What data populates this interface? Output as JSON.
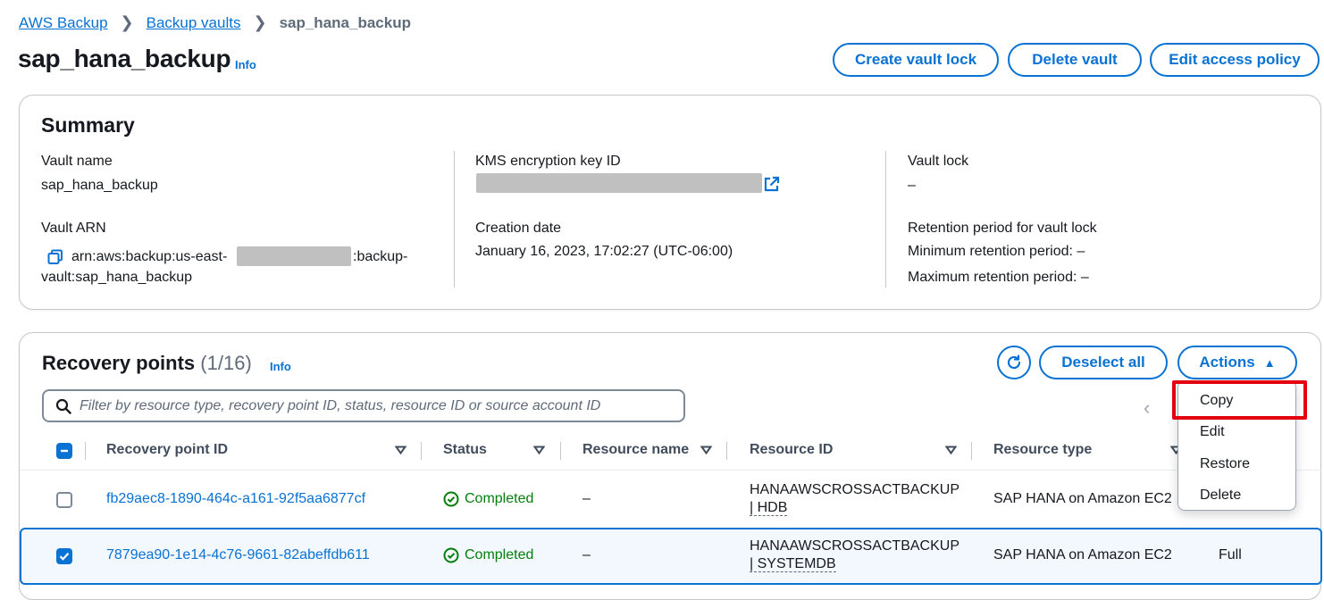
{
  "breadcrumb": {
    "items": [
      "AWS Backup",
      "Backup vaults"
    ],
    "current": "sap_hana_backup"
  },
  "page": {
    "title": "sap_hana_backup",
    "info": "Info"
  },
  "header_actions": {
    "create_vault_lock": "Create vault lock",
    "delete_vault": "Delete vault",
    "edit_access_policy": "Edit access policy"
  },
  "summary": {
    "title": "Summary",
    "vault_name_label": "Vault name",
    "vault_name": "sap_hana_backup",
    "vault_arn_label": "Vault ARN",
    "vault_arn_prefix": "arn:aws:backup:us-east-",
    "vault_arn_suffix": ":backup-",
    "vault_arn_line2": "vault:sap_hana_backup",
    "kms_label": "KMS encryption key ID",
    "creation_date_label": "Creation date",
    "creation_date": "January 16, 2023, 17:02:27 (UTC-06:00)",
    "vault_lock_label": "Vault lock",
    "vault_lock_value": "–",
    "retention_label": "Retention period for vault lock",
    "min_retention": "Minimum retention period: –",
    "max_retention": "Maximum retention period: –"
  },
  "recovery_points": {
    "title": "Recovery points",
    "count": "(1/16)",
    "info": "Info",
    "deselect_all": "Deselect all",
    "actions": "Actions",
    "search_placeholder": "Filter by resource type, recovery point ID, status, resource ID or source account ID",
    "columns": [
      "Recovery point ID",
      "Status",
      "Resource name",
      "Resource ID",
      "Resource type"
    ],
    "rows": [
      {
        "id": "fb29aec8-1890-464c-a161-92f5aa6877cf",
        "status": "Completed",
        "resource_name": "–",
        "resource_id_line1": "HANAAWSCROSSACTBACKUP",
        "resource_id_line2": "| HDB",
        "resource_type": "SAP HANA on Amazon EC2",
        "selected": false
      },
      {
        "id": "7879ea90-1e14-4c76-9661-82abeffdb611",
        "status": "Completed",
        "resource_name": "–",
        "resource_id_line1": "HANAAWSCROSSACTBACKUP",
        "resource_id_line2": "| SYSTEMDB",
        "resource_type": "SAP HANA on Amazon EC2",
        "backup_type": "Full",
        "selected": true
      }
    ],
    "actions_menu": [
      "Copy",
      "Edit",
      "Restore",
      "Delete"
    ]
  },
  "colors": {
    "accent": "#0972d3",
    "success": "#037f0c",
    "highlight": "#e3000f"
  }
}
